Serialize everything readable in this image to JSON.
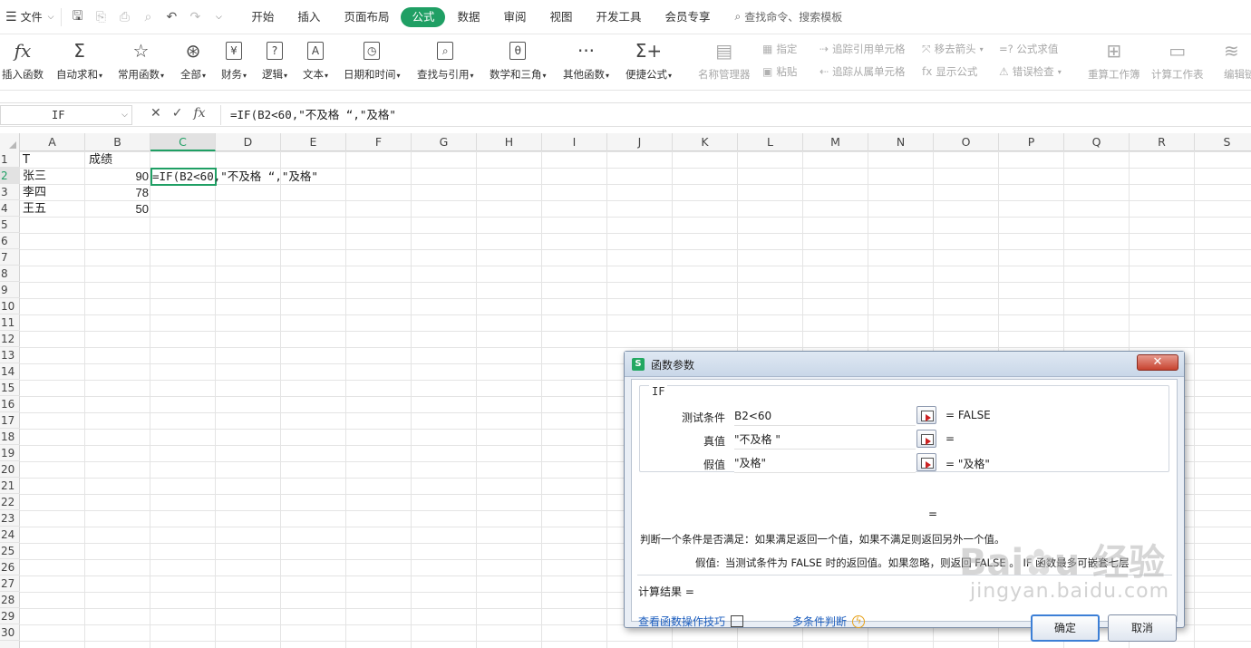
{
  "menubar": {
    "file_label": "文件",
    "tabs": [
      "开始",
      "插入",
      "页面布局",
      "公式",
      "数据",
      "审阅",
      "视图",
      "开发工具",
      "会员专享"
    ],
    "active_tab": "公式",
    "search_label": "查找命令、搜索模板"
  },
  "ribbon": {
    "buttons": [
      {
        "label": "插入函数",
        "icon": "fx-icon"
      },
      {
        "label": "自动求和",
        "icon": "sigma-icon"
      },
      {
        "label": "常用函数",
        "icon": "star-icon"
      },
      {
        "label": "全部",
        "icon": "all-icon"
      },
      {
        "label": "财务",
        "icon": "yen-icon"
      },
      {
        "label": "逻辑",
        "icon": "question-icon"
      },
      {
        "label": "文本",
        "icon": "text-icon"
      },
      {
        "label": "日期和时间",
        "icon": "clock-icon"
      },
      {
        "label": "查找与引用",
        "icon": "lookup-icon"
      },
      {
        "label": "数学和三角",
        "icon": "math-icon"
      },
      {
        "label": "其他函数",
        "icon": "more-icon"
      },
      {
        "label": "便捷公式",
        "icon": "sigma-plus-icon"
      },
      {
        "label": "名称管理器",
        "icon": "name-manager-icon"
      },
      {
        "label": "重算工作簿",
        "icon": "recalc-book-icon"
      },
      {
        "label": "计算工作表",
        "icon": "calc-sheet-icon"
      },
      {
        "label": "编辑链",
        "icon": "edit-link-icon"
      }
    ],
    "small": {
      "define": "指定",
      "paste": "粘贴",
      "trace_precedents": "追踪引用单元格",
      "trace_dependents": "追踪从属单元格",
      "remove_arrows": "移去箭头",
      "show_formulas": "显示公式",
      "evaluate": "=? 公式求值",
      "error_check": "错误检查"
    }
  },
  "formula_bar": {
    "name_box": "IF",
    "formula": "=IF(B2<60,\"不及格 “,\"及格\""
  },
  "grid": {
    "columns": [
      "A",
      "B",
      "C",
      "D",
      "E",
      "F",
      "G",
      "H",
      "I",
      "J",
      "K",
      "L",
      "M",
      "N",
      "O",
      "P",
      "Q",
      "R",
      "S"
    ],
    "selected_column": "C",
    "rows": [
      "1",
      "2",
      "3",
      "4",
      "5",
      "6",
      "7",
      "8",
      "9",
      "10",
      "11",
      "12",
      "13",
      "14",
      "15",
      "16",
      "17",
      "18",
      "19",
      "20",
      "21",
      "22",
      "23",
      "24",
      "25",
      "26",
      "27",
      "28",
      "29",
      "30"
    ],
    "selected_row": "2",
    "cells": {
      "A1": "T",
      "B1": "成绩",
      "A2": "张三",
      "B2": "90",
      "C2": "=IF(B2<60,\"不及格 “,\"及格\"",
      "A3": "李四",
      "B3": "78",
      "A4": "王五",
      "B4": "50"
    }
  },
  "dialog": {
    "title": "函数参数",
    "function_name": "IF",
    "args": [
      {
        "name": "测试条件",
        "value": "B2<60",
        "result": "= FALSE"
      },
      {
        "name": "真值",
        "value": "\"不及格 \"",
        "result": "="
      },
      {
        "name": "假值",
        "value": "\"及格\"",
        "result": "= \"及格\""
      }
    ],
    "overall_eq": "=",
    "description": "判断一个条件是否满足：如果满足返回一个值，如果不满足则返回另外一个值。",
    "hint_label": "假值:",
    "hint_text": "当测试条件为 FALSE 时的返回值。如果忽略，则返回 FALSE 。 IF 函数最多可嵌套七层",
    "result_label": "计算结果 =",
    "link_tips": "查看函数操作技巧",
    "link_multi": "多条件判断",
    "ok_label": "确定",
    "cancel_label": "取消"
  },
  "watermark": {
    "brand": "Baidu经验",
    "url": "jingyan.baidu.com"
  }
}
